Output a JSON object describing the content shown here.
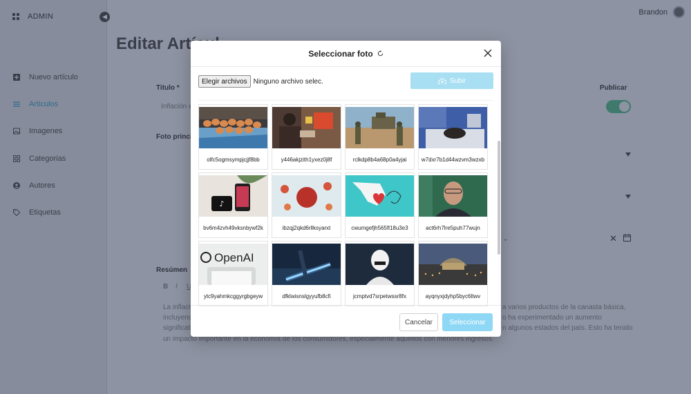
{
  "app": {
    "brand": "ADMIN",
    "user_name": "Brandon"
  },
  "sidebar": {
    "items": [
      {
        "label": "Nuevo artículo",
        "icon": "plus-square-icon"
      },
      {
        "label": "Articulos",
        "icon": "list-icon",
        "active": true
      },
      {
        "label": "Imagenes",
        "icon": "image-icon"
      },
      {
        "label": "Categorias",
        "icon": "grid-icon"
      },
      {
        "label": "Autores",
        "icon": "user-icon"
      },
      {
        "label": "Etiquetas",
        "icon": "tag-icon"
      }
    ]
  },
  "page": {
    "title": "Editar Artícul",
    "title_label": "Titulo *",
    "title_value": "Inflación e",
    "publish_label": "Publicar",
    "photo_label": "Foto princi",
    "summary_label": "Resúmen",
    "editor_tools": [
      "B",
      "I",
      "U"
    ],
    "body_lines": [
      "La inflació",
      "incluyend",
      "significati",
      "un impacto importante en la economía de los consumidores, especialmente aquellos con menores ingresos."
    ],
    "body_lines_right": [
      "a varios productos de la canasta básica,",
      "o ha experimentado un aumento",
      "n algunos estados del país. Esto ha tenido"
    ]
  },
  "modal": {
    "title": "Seleccionar foto",
    "file_button": "Elegir archivos",
    "file_status": "Ninguno archivo selec.",
    "upload_button": "Subir",
    "cancel_button": "Cancelar",
    "select_button": "Seleccionar",
    "photos": [
      {
        "caption": "olfc5ogmsympjcjjf8bb"
      },
      {
        "caption": "y446akjzith1yxez0j8f"
      },
      {
        "caption": "rclkdp8b4a68p0a4yjai"
      },
      {
        "caption": "w7dxr7b1d44wzvm3wzxb"
      },
      {
        "caption": "bv6m4zvh49vksnbywf2k"
      },
      {
        "caption": "ibzqj2qkd6rllksyarxt"
      },
      {
        "caption": "cwumgefjh565fl18u3e3"
      },
      {
        "caption": "act6rh7lre5puh77wujn"
      },
      {
        "caption": "ytc9yahmkcggyrgbgeyw",
        "logo_text": "OpenAI"
      },
      {
        "caption": "dfklwisnslgyyufb8cfi"
      },
      {
        "caption": "jcmptvd7srpetwssr8fx"
      },
      {
        "caption": "ayqnyxjdyhp5byc6ltwv"
      }
    ]
  },
  "colors": {
    "accent": "#8fd8f5",
    "upload_disabled": "#a8dff3",
    "overlay": "#8e93a3"
  }
}
